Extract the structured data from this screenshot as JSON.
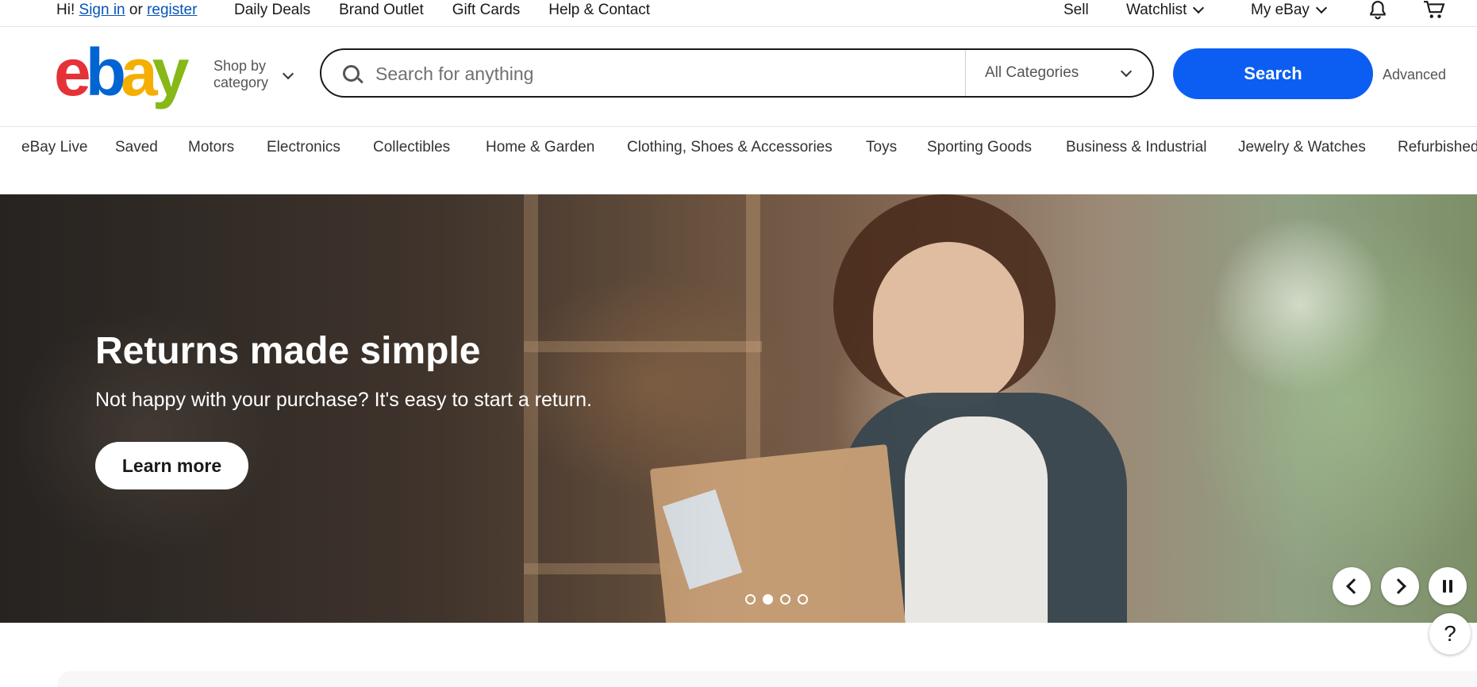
{
  "topbar": {
    "greeting": "Hi!",
    "sign_in": "Sign in",
    "or": "or",
    "register": "register",
    "links": [
      "Daily Deals",
      "Brand Outlet",
      "Gift Cards",
      "Help & Contact"
    ],
    "sell": "Sell",
    "watchlist": "Watchlist",
    "my_ebay": "My eBay",
    "icons": [
      "bell-icon",
      "cart-icon"
    ]
  },
  "header": {
    "logo": {
      "e": "e",
      "b": "b",
      "a": "a",
      "y": "y"
    },
    "shop_by_line1": "Shop by",
    "shop_by_line2": "category",
    "search_placeholder": "Search for anything",
    "category_select": "All Categories",
    "search_button": "Search",
    "advanced": "Advanced",
    "colors": {
      "e": "#e53238",
      "b": "#0064d2",
      "a": "#f5af02",
      "y": "#86b817",
      "search_button": "#0c5ef3"
    }
  },
  "catnav": {
    "items": [
      "eBay Live",
      "Saved",
      "Motors",
      "Electronics",
      "Collectibles",
      "Home & Garden",
      "Clothing, Shoes & Accessories",
      "Toys",
      "Sporting Goods",
      "Business & Industrial",
      "Jewelry & Watches",
      "Refurbished"
    ]
  },
  "hero": {
    "title": "Returns made simple",
    "subtitle": "Not happy with your purchase? It's easy to start a return.",
    "cta": "Learn more",
    "active_slide": 2,
    "slide_count": 4
  },
  "help": {
    "label": "?"
  }
}
